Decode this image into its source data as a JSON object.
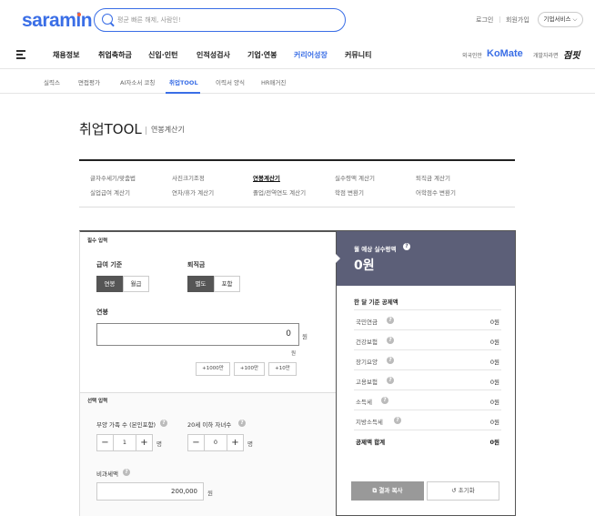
{
  "header": {
    "logo": "saramin",
    "search_placeholder": "평균 빠른 해제, 사람인!",
    "util_links": [
      "로그인",
      "회원가입"
    ],
    "biz_service": "기업서비스 ⌵"
  },
  "gnb": {
    "items": [
      "채용정보",
      "취업축하금",
      "신입·인턴",
      "인적성검사",
      "기업·연봉",
      "커리어성장",
      "커뮤니티"
    ],
    "active_index": 5,
    "right_label_1": "외국인만 ",
    "komate": "KoMate",
    "right_label_2": "개발자라면",
    "jumpit": "점핏"
  },
  "lnb": {
    "items": [
      "실력스",
      "면접평가",
      "AI자소서 코칭",
      "취업TOOL",
      "이력서 양식",
      "HR매거진"
    ],
    "active_index": 3
  },
  "page": {
    "title": "취업TOOL",
    "subtitle": "연봉계산기"
  },
  "tool_menu": {
    "row1": [
      "글자수세기/맞춤법",
      "사진크기조정",
      "연봉계산기",
      "실수령액 계산기",
      "퇴직금 계산기"
    ],
    "row2": [
      "실업급여 계산기",
      "연차/휴가 계산기",
      "졸업/전역연도 계산기",
      "학점 변환기",
      "어학점수 변환기"
    ],
    "active": "연봉계산기"
  },
  "calc": {
    "required_label": "필수 입력",
    "salary_base_label": "급여 기준",
    "salary_base_options": [
      "연봉",
      "월급"
    ],
    "severance_label": "퇴직금",
    "severance_options": [
      "별도",
      "포함"
    ],
    "salary_label": "연봉",
    "salary_value": "0",
    "unit_won": "원",
    "salary_hint_unit": "원",
    "quick_buttons": [
      "+1000만",
      "+100만",
      "+10만"
    ],
    "optional_label": "선택 입력",
    "dependents_label": "부양 가족 수 (본인포함)",
    "dependents_value": "1",
    "children_label": "20세 이하 자녀수",
    "children_value": "0",
    "people_unit": "명",
    "nontax_label": "비과세액",
    "nontax_value": "200,000",
    "help_glyph": "?",
    "minus": "−",
    "plus": "+"
  },
  "result": {
    "label": "월 예상 실수령액",
    "amount": "0원",
    "deduction_title": "한 달 기준 공제액",
    "deductions": [
      {
        "name": "국민연금",
        "amount": "0원"
      },
      {
        "name": "건강보험",
        "amount": "0원"
      },
      {
        "name": "장기요양",
        "amount": "0원"
      },
      {
        "name": "고용보험",
        "amount": "0원"
      },
      {
        "name": "소득세",
        "amount": "0원"
      },
      {
        "name": "지방소득세",
        "amount": "0원"
      }
    ],
    "total_label": "공제액 합계",
    "total_amount": "0원",
    "copy_button": "결과 복사",
    "reset_button": "초기화",
    "copy_icon": "⧉",
    "reset_icon": "↺"
  }
}
